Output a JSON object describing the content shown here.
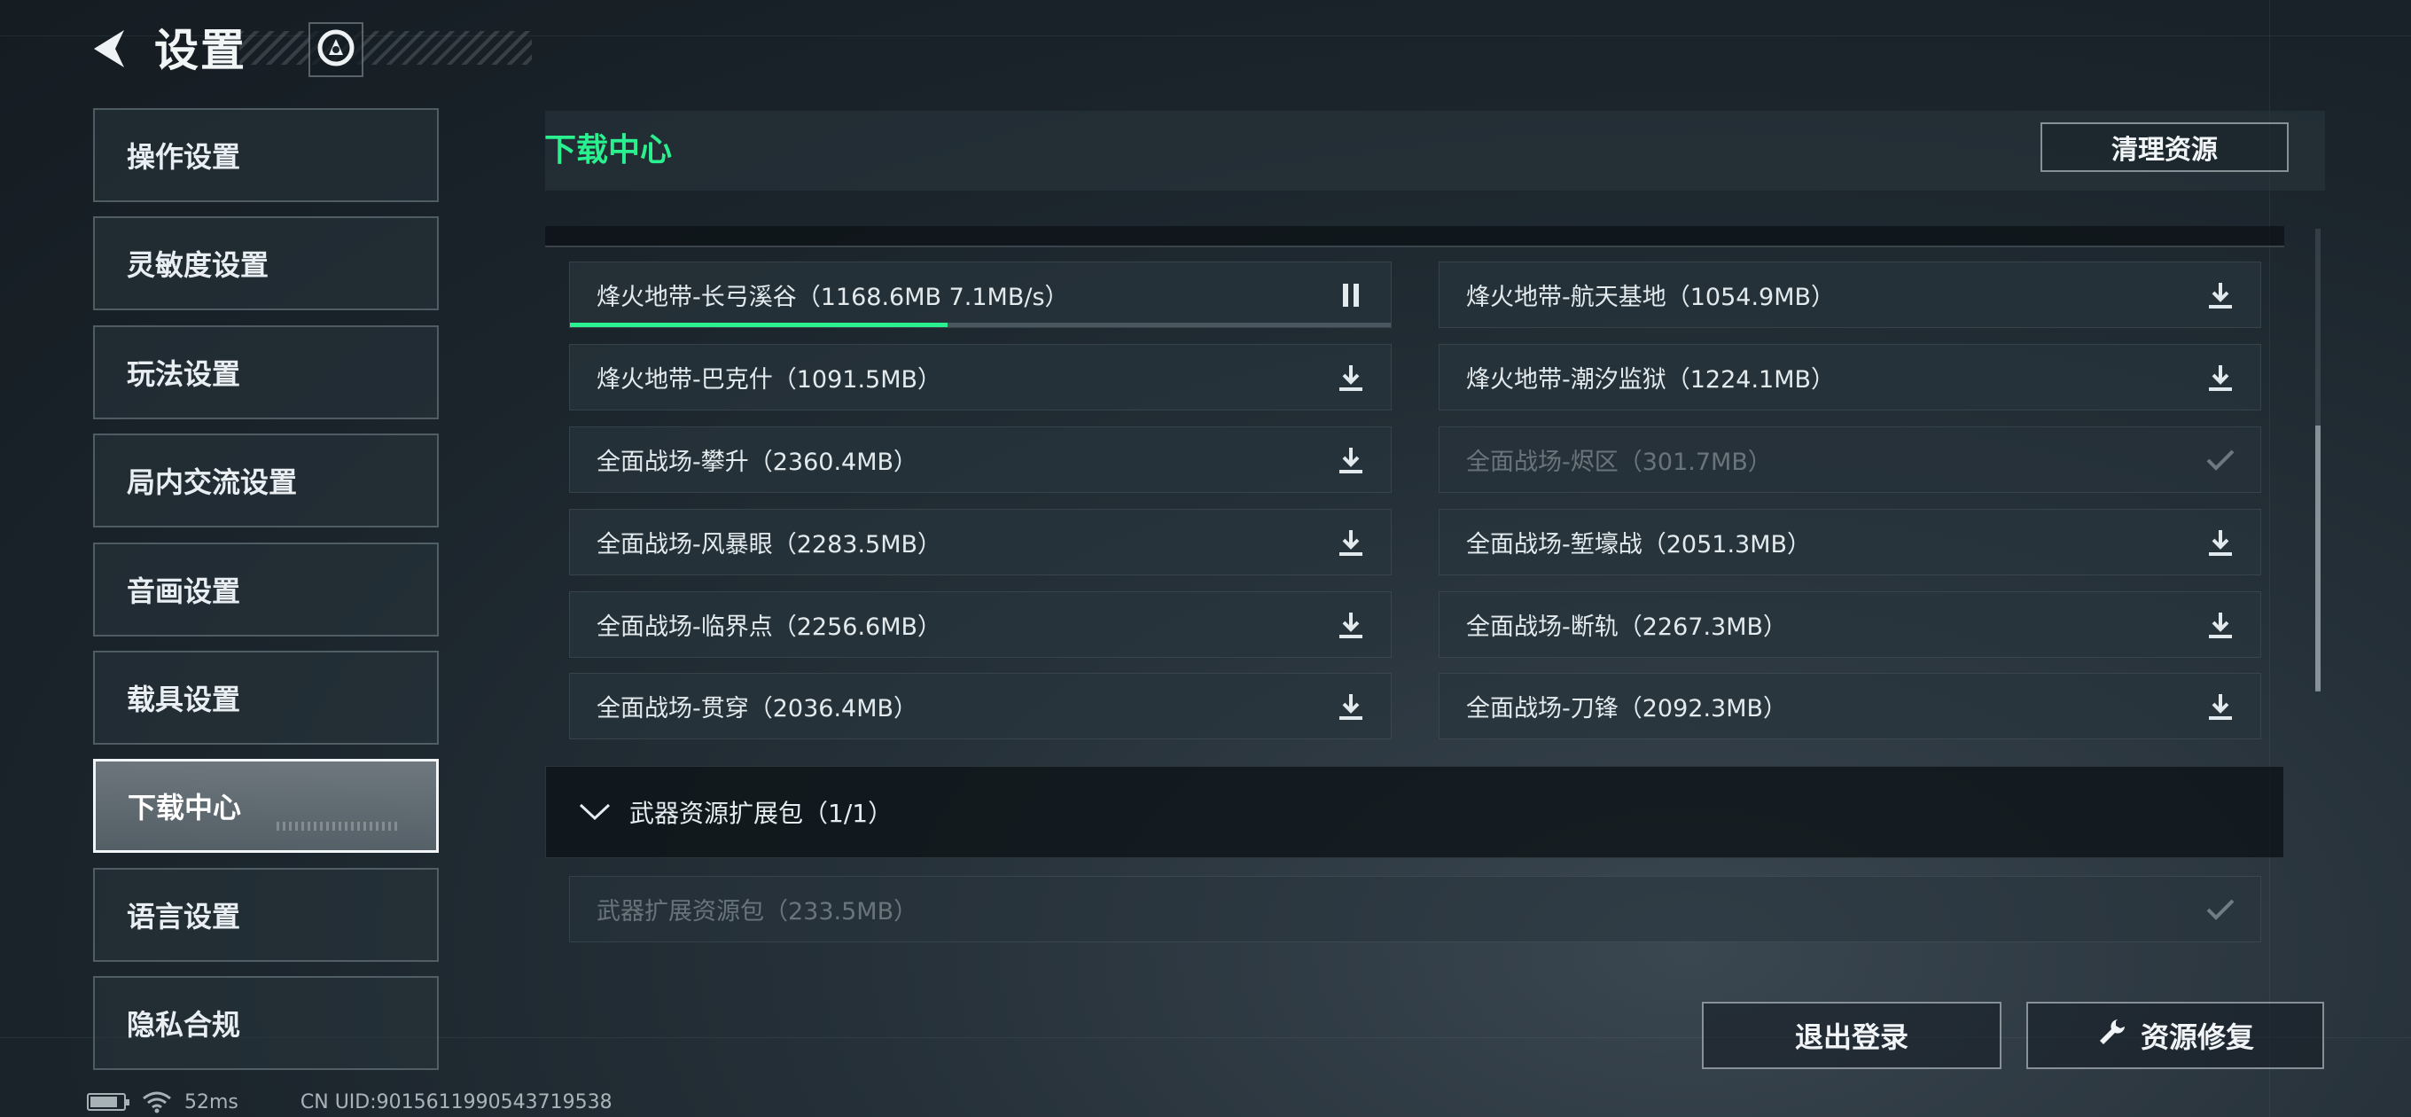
{
  "header": {
    "title": "设置",
    "back_icon": "back-arrow-icon",
    "account_icon": "account-emblem-icon"
  },
  "sidebar": {
    "items": [
      {
        "label": "操作设置",
        "active": false
      },
      {
        "label": "灵敏度设置",
        "active": false
      },
      {
        "label": "玩法设置",
        "active": false
      },
      {
        "label": "局内交流设置",
        "active": false
      },
      {
        "label": "音画设置",
        "active": false
      },
      {
        "label": "载具设置",
        "active": false
      },
      {
        "label": "下载中心",
        "active": true
      },
      {
        "label": "语言设置",
        "active": false
      },
      {
        "label": "隐私合规",
        "active": false
      }
    ]
  },
  "main": {
    "title": "下载中心",
    "clean_button": "清理资源",
    "maps": [
      {
        "label": "烽火地带-长弓溪谷（1168.6MB 7.1MB/s）",
        "state": "downloading",
        "progress": 0.46,
        "icon": "pause-icon"
      },
      {
        "label": "烽火地带-航天基地（1054.9MB）",
        "state": "available",
        "icon": "download-icon"
      },
      {
        "label": "烽火地带-巴克什（1091.5MB）",
        "state": "available",
        "icon": "download-icon"
      },
      {
        "label": "烽火地带-潮汐监狱（1224.1MB）",
        "state": "available",
        "icon": "download-icon"
      },
      {
        "label": "全面战场-攀升（2360.4MB）",
        "state": "available",
        "icon": "download-icon"
      },
      {
        "label": "全面战场-烬区（301.7MB）",
        "state": "done",
        "icon": "check-icon"
      },
      {
        "label": "全面战场-风暴眼（2283.5MB）",
        "state": "available",
        "icon": "download-icon"
      },
      {
        "label": "全面战场-堑壕战（2051.3MB）",
        "state": "available",
        "icon": "download-icon"
      },
      {
        "label": "全面战场-临界点（2256.6MB）",
        "state": "available",
        "icon": "download-icon"
      },
      {
        "label": "全面战场-断轨（2267.3MB）",
        "state": "available",
        "icon": "download-icon"
      },
      {
        "label": "全面战场-贯穿（2036.4MB）",
        "state": "available",
        "icon": "download-icon"
      },
      {
        "label": "全面战场-刀锋（2092.3MB）",
        "state": "available",
        "icon": "download-icon"
      }
    ],
    "weapon_group": {
      "label": "武器资源扩展包（1/1）",
      "expanded": true,
      "items": [
        {
          "label": "武器扩展资源包（233.5MB）",
          "state": "done",
          "icon": "check-icon"
        }
      ]
    }
  },
  "footer": {
    "logout_button": "退出登录",
    "repair_button": "资源修复",
    "repair_icon": "wrench-icon"
  },
  "status_bar": {
    "ping": "52ms",
    "uid": "CN UID:9015611990543719538"
  },
  "colors": {
    "accent": "#2bf08f",
    "background": "#1b242b"
  }
}
